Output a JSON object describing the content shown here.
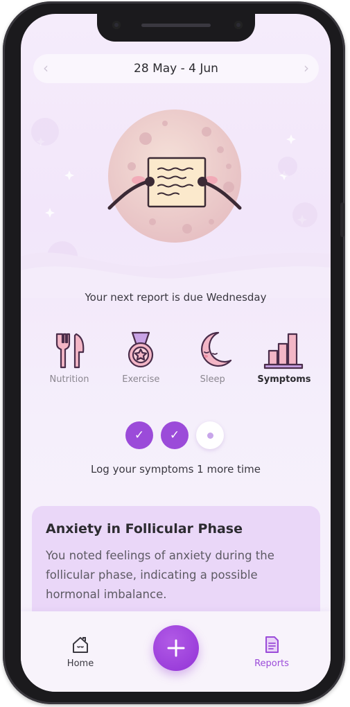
{
  "header": {
    "date_range": "28 May - 4 Jun",
    "prev_icon": "chevron-left-icon",
    "next_icon": "chevron-right-icon"
  },
  "report": {
    "next_report_text": "Your next report is due Wednesday"
  },
  "categories": [
    {
      "label": "Nutrition",
      "icon": "fork-knife-icon",
      "active": false
    },
    {
      "label": "Exercise",
      "icon": "medal-icon",
      "active": false
    },
    {
      "label": "Sleep",
      "icon": "moon-icon",
      "active": false
    },
    {
      "label": "Symptoms",
      "icon": "bar-chart-icon",
      "active": true
    }
  ],
  "progress": {
    "completed": 2,
    "total": 3,
    "check_glyph": "✓",
    "message": "Log your symptoms 1 more time"
  },
  "insight": {
    "title": "Anxiety in Follicular Phase",
    "body": "You noted feelings of anxiety during the follicular phase, indicating a possible hormonal imbalance."
  },
  "nav": {
    "home_label": "Home",
    "reports_label": "Reports",
    "add_icon": "plus-icon",
    "active": "Reports"
  },
  "colors": {
    "accent": "#9b4bd9",
    "active_nav": "#9b4bd9",
    "inactive_nav": "#3a3840",
    "card_bg": "#ead7f8",
    "icon_pink": "#f3b6c6"
  }
}
